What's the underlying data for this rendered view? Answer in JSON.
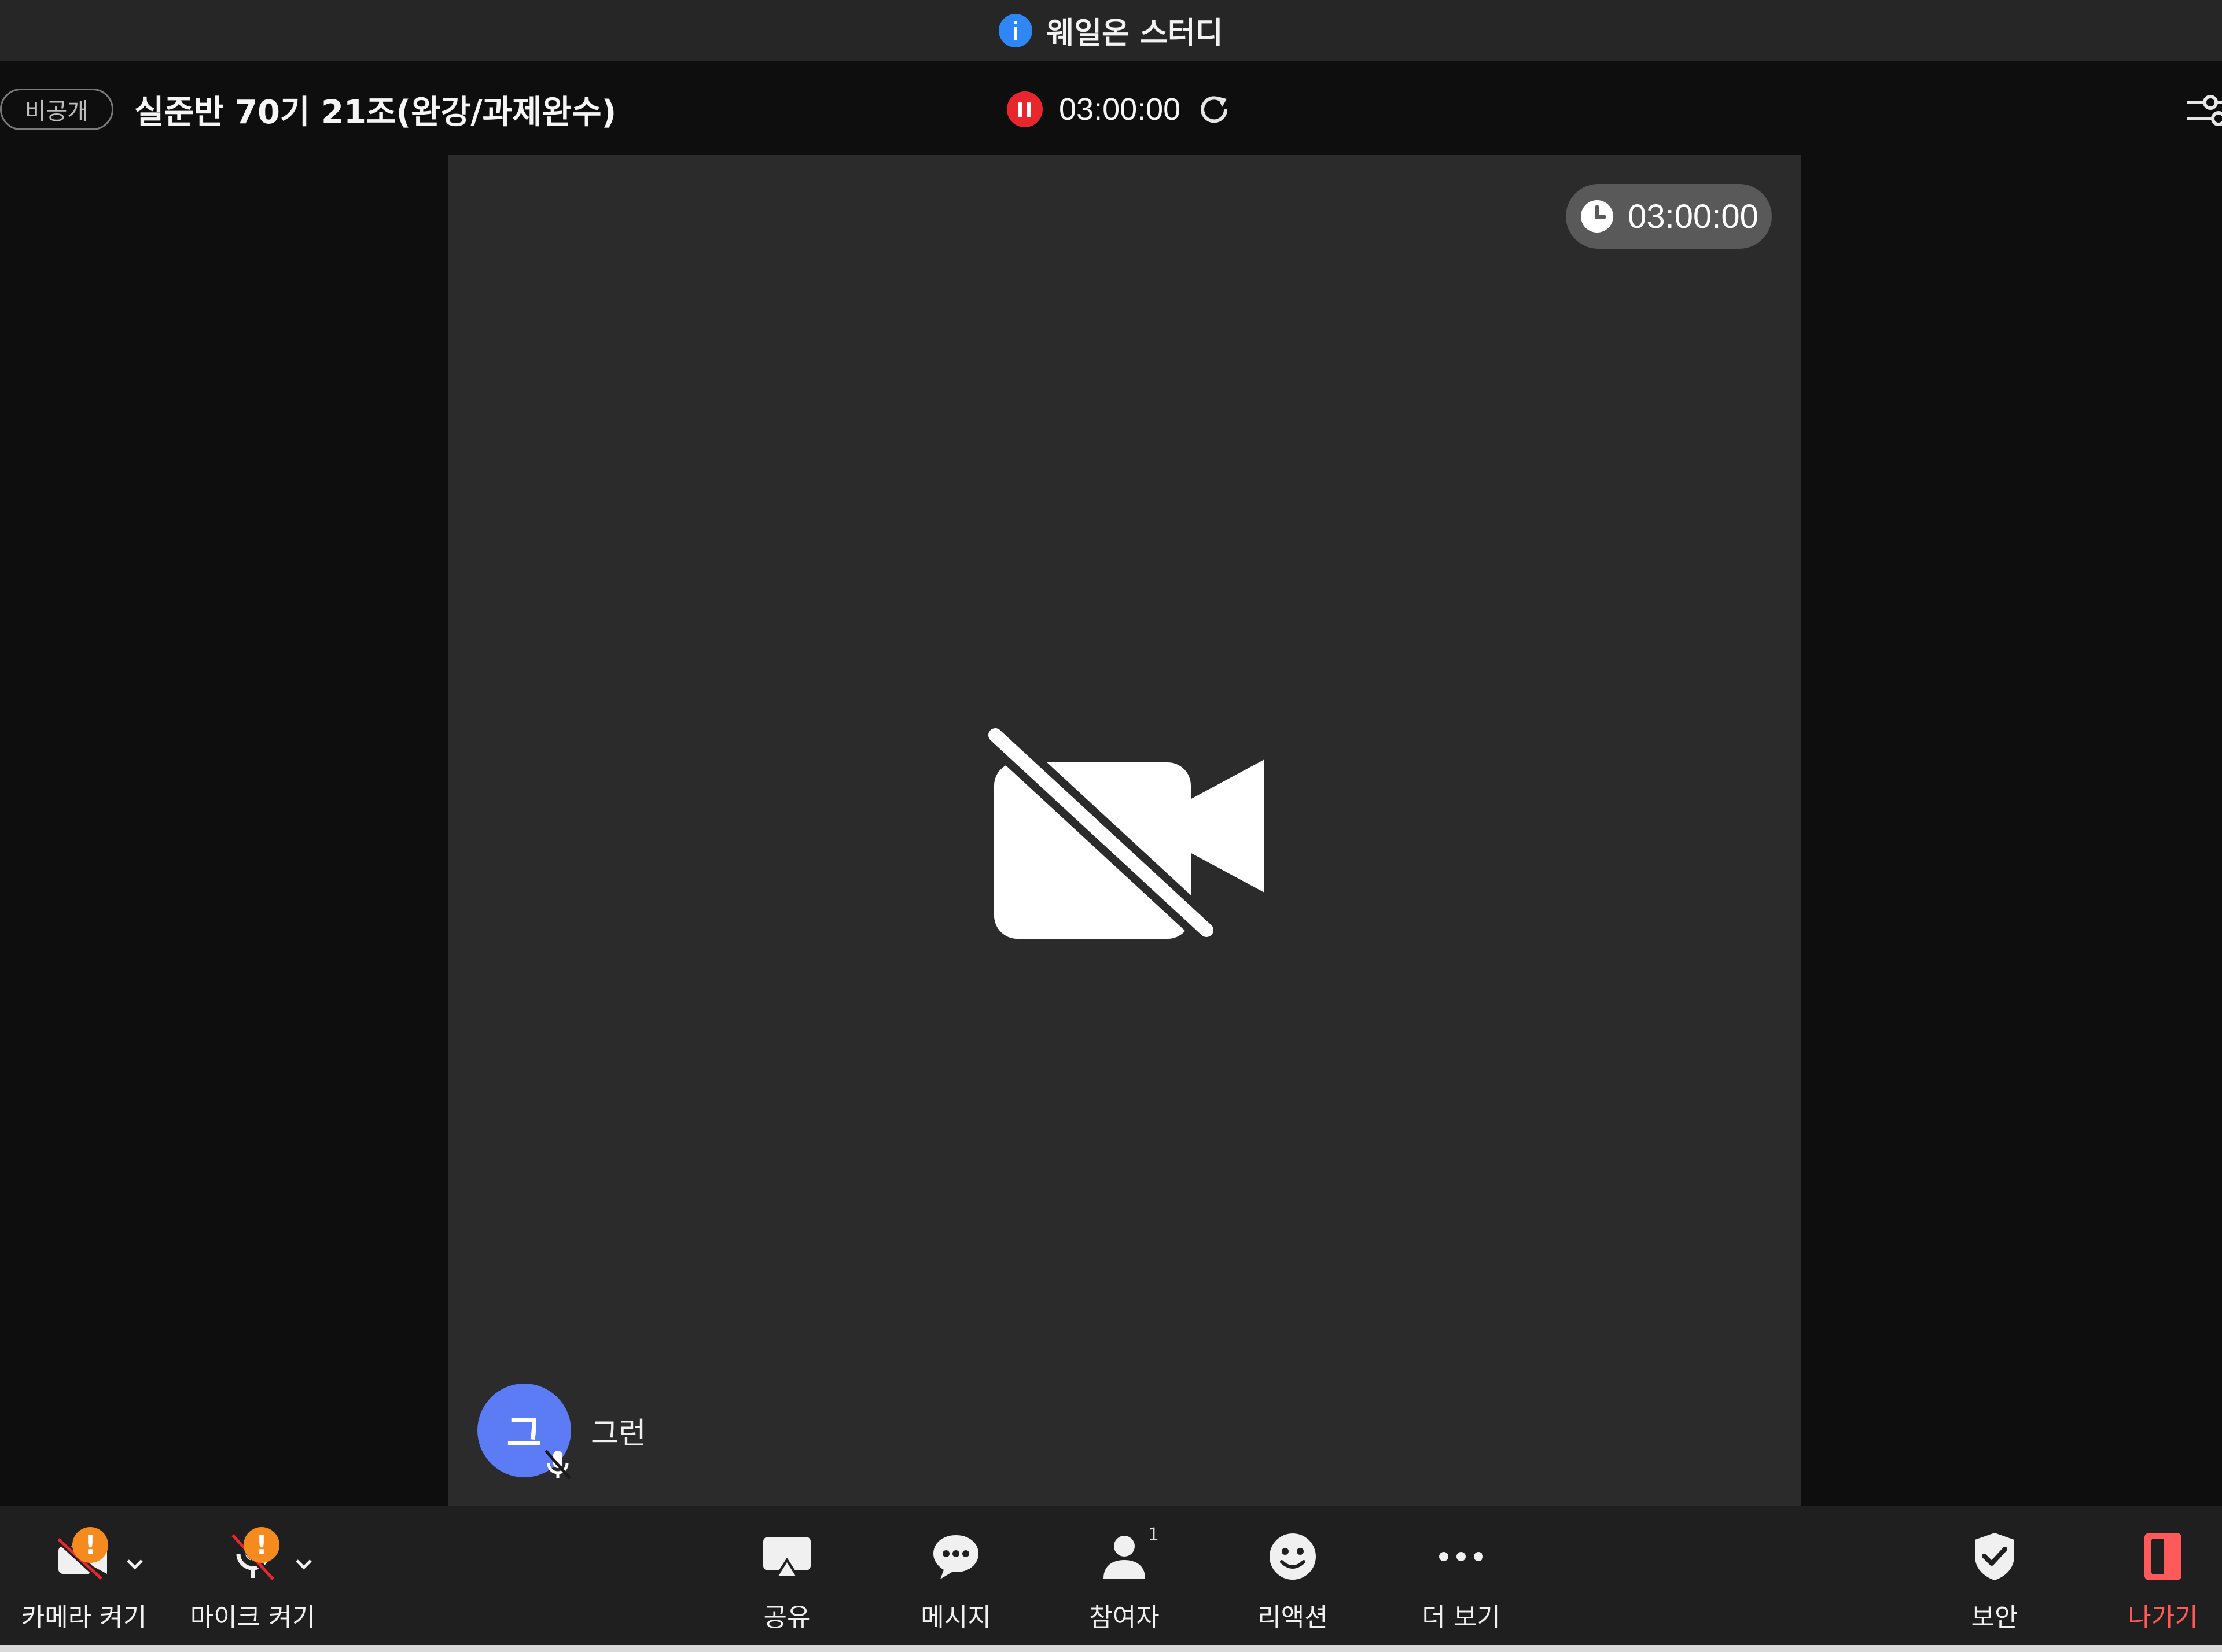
{
  "window": {
    "title": "웨일온 스터디"
  },
  "infobar": {
    "privacy_badge": "비공개",
    "meeting_title": "실준반 70기 21조(완강/과제완수)",
    "recording_time": "03:00:00"
  },
  "video": {
    "timer": "03:00:00",
    "participant_initial": "그",
    "participant_name": "그런",
    "avatar_color": "#5b7cf5"
  },
  "toolbar": {
    "camera_label": "카메라 켜기",
    "mic_label": "마이크 켜기",
    "share_label": "공유",
    "message_label": "메시지",
    "participants_label": "참여자",
    "participants_count": "1",
    "reaction_label": "리액션",
    "more_label": "더 보기",
    "security_label": "보안",
    "leave_label": "나가기"
  },
  "colors": {
    "accent_blue": "#2f86f6",
    "record_red": "#e8262d",
    "warning_orange": "#f58a1f",
    "leave_red": "#ff5a5a"
  }
}
